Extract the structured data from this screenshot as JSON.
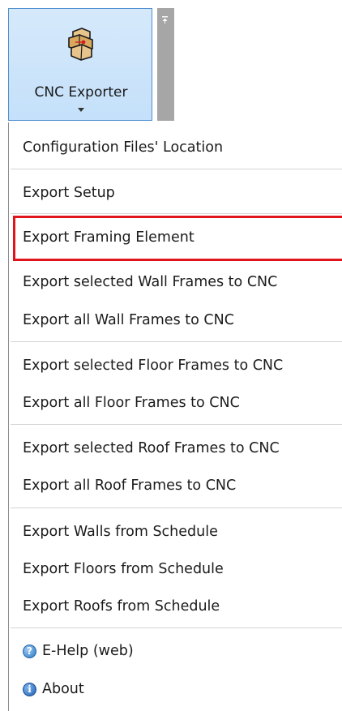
{
  "ribbon": {
    "button_label": "CNC Exporter",
    "icon": "cnc-exporter-icon"
  },
  "menu": {
    "items": [
      {
        "label": "Configuration Files' Location"
      },
      {
        "label": "Export Setup"
      },
      {
        "label": "Export Framing Element",
        "highlighted": true
      },
      {
        "label": "Export selected Wall Frames to CNC"
      },
      {
        "label": "Export all Wall Frames to CNC"
      },
      {
        "label": "Export selected Floor Frames to CNC"
      },
      {
        "label": "Export all Floor Frames to CNC"
      },
      {
        "label": "Export selected Roof Frames to CNC"
      },
      {
        "label": "Export all Roof Frames to CNC"
      },
      {
        "label": "Export Walls from Schedule"
      },
      {
        "label": "Export Floors from Schedule"
      },
      {
        "label": "Export Roofs from Schedule"
      },
      {
        "label": "E-Help (web)",
        "icon": "help-icon"
      },
      {
        "label": "About",
        "icon": "info-icon"
      }
    ]
  },
  "colors": {
    "ribbon_border": "#4f90d0",
    "ribbon_fill": "#c4e0fa",
    "highlight_border": "#e0141b",
    "separator": "#d4d4d4"
  }
}
